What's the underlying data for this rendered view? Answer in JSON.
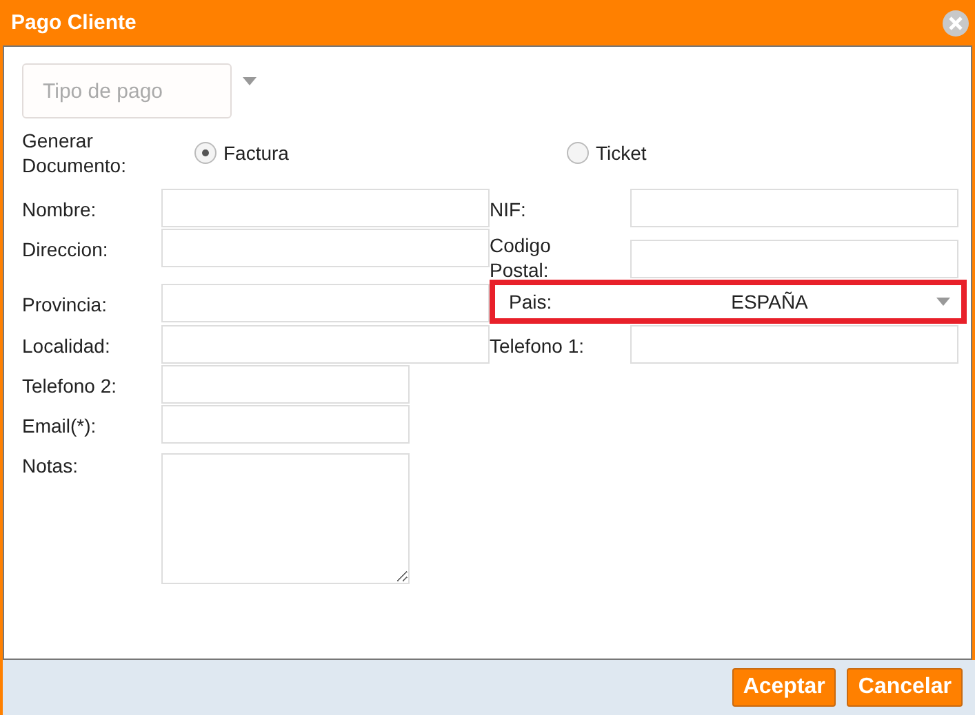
{
  "window": {
    "title": "Pago Cliente"
  },
  "payment_type": {
    "placeholder": "Tipo de pago"
  },
  "document": {
    "label": "Generar Documento:",
    "options": [
      {
        "label": "Factura",
        "selected": true
      },
      {
        "label": "Ticket",
        "selected": false
      }
    ]
  },
  "rows": [
    {
      "left": {
        "label": "Nombre:",
        "kind": "text"
      },
      "right": {
        "label": "NIF:",
        "kind": "text"
      }
    },
    {
      "left": {
        "label": "Direccion:",
        "kind": "text"
      },
      "right": {
        "label": "Codigo Postal:",
        "kind": "text"
      }
    },
    {
      "left": {
        "label": "Provincia:",
        "kind": "text"
      },
      "right": {
        "label": "Pais:",
        "kind": "select",
        "value": "ESPAÑA",
        "highlighted": true
      }
    },
    {
      "left": {
        "label": "Localidad:",
        "kind": "text"
      },
      "right": {
        "label": "Telefono 1:",
        "kind": "text"
      }
    },
    {
      "left": {
        "label": "Telefono 2:",
        "kind": "short"
      }
    },
    {
      "left": {
        "label": "Email(*):",
        "kind": "short"
      }
    },
    {
      "left": {
        "label": "Notas:",
        "kind": "textarea"
      }
    }
  ],
  "buttons": [
    "Aceptar",
    "Cancelar"
  ]
}
